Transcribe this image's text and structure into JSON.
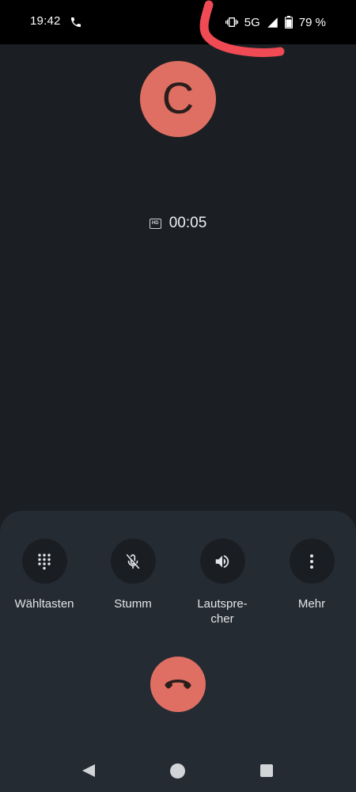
{
  "status_bar": {
    "time": "19:42",
    "network": "5G",
    "battery": "79 %"
  },
  "caller": {
    "avatar_letter": "C",
    "avatar_color": "#e06f63"
  },
  "call": {
    "hd_badge": "HD",
    "duration": "00:05"
  },
  "controls": [
    {
      "label": "Wähltasten",
      "icon": "dialpad-icon"
    },
    {
      "label": "Stumm",
      "icon": "mic-off-icon"
    },
    {
      "label": "Lautspre-\ncher",
      "icon": "speaker-icon"
    },
    {
      "label": "Mehr",
      "icon": "more-vert-icon"
    }
  ],
  "end_call": {
    "icon": "end-call-icon",
    "color": "#e06f63"
  },
  "colors": {
    "background": "#1b1f23",
    "panel": "#252b33",
    "accent": "#e06f63"
  }
}
